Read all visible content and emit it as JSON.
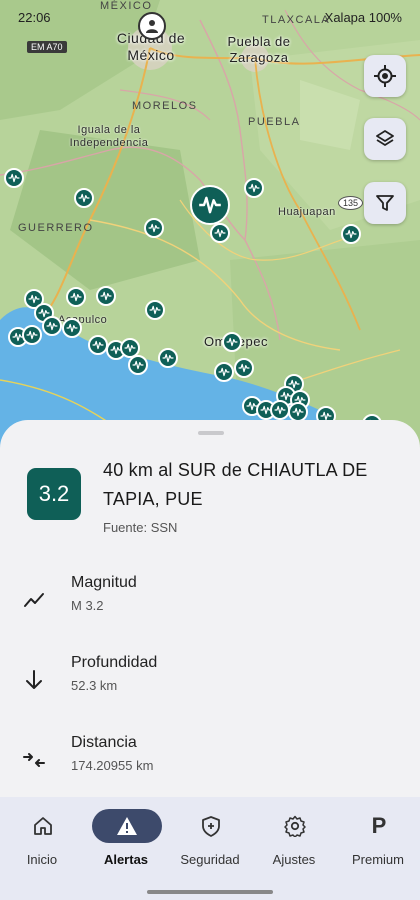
{
  "status_bar": {
    "time": "22:06",
    "right_text": "Xalapa 100%"
  },
  "map": {
    "cities": [
      "Ciudad de México",
      "Puebla de Zaragoza",
      "Ometepec"
    ],
    "states": [
      "TLAXCALA",
      "MORELOS",
      "PUEBLA",
      "GUERRERO",
      "MÉXICO"
    ],
    "towns": [
      "Iguala de la Independencia",
      "Huajuapan",
      "Acapulco"
    ],
    "road_sign": "EM A70",
    "route_badge": "135"
  },
  "event": {
    "magnitude_badge": "3.2",
    "title": "40 km al SUR de CHIAUTLA DE TAPIA, PUE",
    "source": "Fuente: SSN",
    "details": [
      {
        "label": "Magnitud",
        "value": "M 3.2",
        "icon": "trend-icon"
      },
      {
        "label": "Profundidad",
        "value": "52.3 km",
        "icon": "arrow-down-icon"
      },
      {
        "label": "Distancia",
        "value": "174.20955 km",
        "icon": "compress-icon"
      }
    ]
  },
  "nav": {
    "items": [
      {
        "label": "Inicio",
        "icon": "home-icon"
      },
      {
        "label": "Alertas",
        "icon": "warning-icon",
        "active": true
      },
      {
        "label": "Seguridad",
        "icon": "shield-icon"
      },
      {
        "label": "Ajustes",
        "icon": "gear-icon"
      },
      {
        "label": "Premium",
        "icon": "premium-p-icon"
      }
    ]
  },
  "colors": {
    "accent": "#0f5f57",
    "nav_bg": "#e7e9f3",
    "active_pill": "#3d4a6b",
    "sea": "#64b3e6"
  }
}
